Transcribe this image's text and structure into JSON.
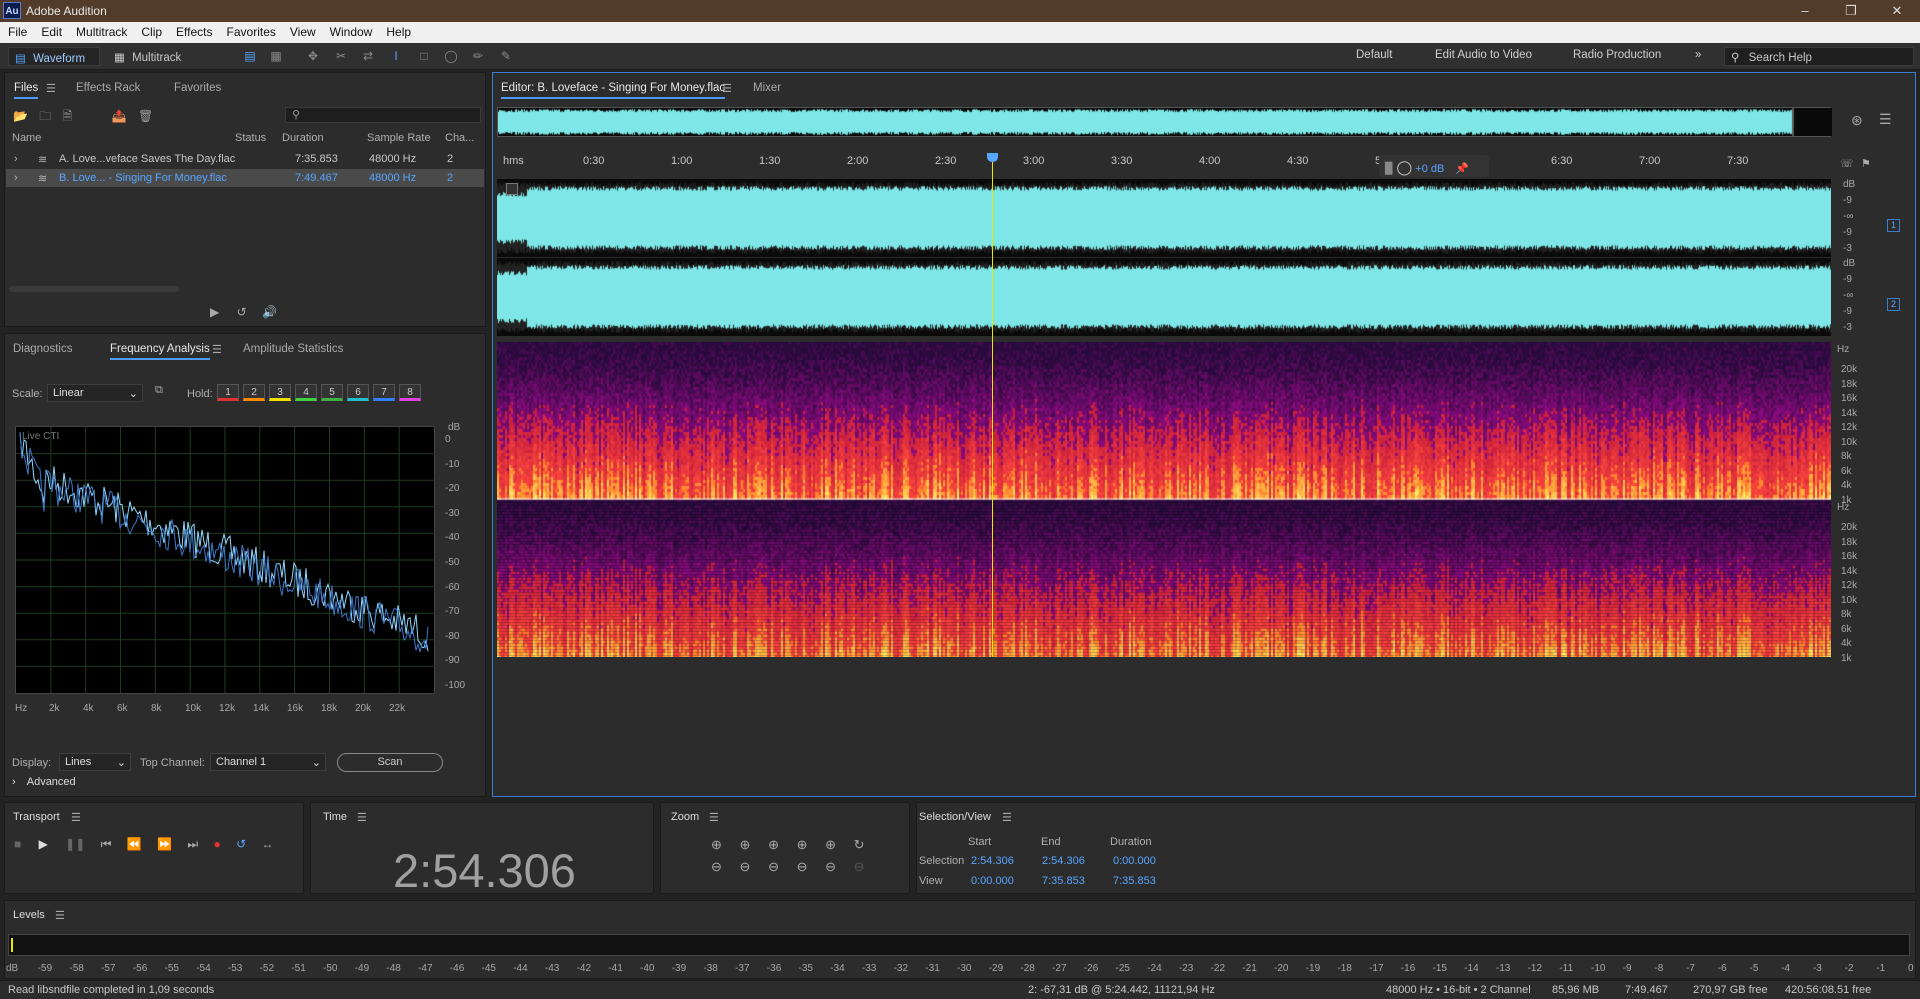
{
  "window": {
    "title": "Adobe Audition",
    "icon_label": "Au"
  },
  "menu": [
    "File",
    "Edit",
    "Multitrack",
    "Clip",
    "Effects",
    "Favorites",
    "View",
    "Window",
    "Help"
  ],
  "toolbar": {
    "waveform_label": "Waveform",
    "multitrack_label": "Multitrack",
    "workspaces": [
      "Default",
      "Edit Audio to Video",
      "Radio Production"
    ],
    "search_placeholder": "Search Help"
  },
  "files_panel": {
    "tabs": [
      "Files",
      "Effects Rack",
      "Favorites"
    ],
    "columns": [
      "Name",
      "Status",
      "Duration",
      "Sample Rate",
      "Cha..."
    ],
    "rows": [
      {
        "name": "A. Love...veface Saves The Day.flac",
        "status": "",
        "duration": "7:35.853",
        "rate": "48000 Hz",
        "ch": "2"
      },
      {
        "name": "B. Love... - Singing For Money.flac",
        "status": "",
        "duration": "7:49.467",
        "rate": "48000 Hz",
        "ch": "2"
      }
    ],
    "selected_row": 1
  },
  "analysis_panel": {
    "tabs": [
      "Diagnostics",
      "Frequency Analysis",
      "Amplitude Statistics"
    ],
    "scale_label": "Scale:",
    "scale_value": "Linear",
    "hold_label": "Hold:",
    "hold_buttons": [
      "1",
      "2",
      "3",
      "4",
      "5",
      "6",
      "7",
      "8"
    ],
    "hold_colors": [
      "#e03030",
      "#ff8a00",
      "#f0e000",
      "#40d040",
      "#40b040",
      "#20c0d0",
      "#3080ff",
      "#e040e0"
    ],
    "live_cti": "Live CTI",
    "db_unit": "dB",
    "db_ticks": [
      "0",
      "-10",
      "-20",
      "-30",
      "-40",
      "-50",
      "-60",
      "-70",
      "-80",
      "-90",
      "-100"
    ],
    "hz_ticks": [
      "Hz",
      "2k",
      "4k",
      "6k",
      "8k",
      "10k",
      "12k",
      "14k",
      "16k",
      "18k",
      "20k",
      "22k"
    ],
    "display_label": "Display:",
    "display_value": "Lines",
    "top_channel_label": "Top Channel:",
    "top_channel_value": "Channel 1",
    "scan_label": "Scan",
    "advanced_label": "Advanced"
  },
  "editor": {
    "tabs": [
      "Editor: B. Loveface - Singing For Money.flac",
      "Mixer"
    ],
    "time_unit": "hms",
    "time_ticks": [
      "0:30",
      "1:00",
      "1:30",
      "2:00",
      "2:30",
      "3:00",
      "3:30",
      "4:00",
      "4:30",
      "5:",
      "6:00",
      "6:30",
      "7:00",
      "7:30"
    ],
    "hud_gain": "+0 dB",
    "channel_db_labels": [
      "dB",
      "-9",
      "-∞",
      "-9",
      "-3"
    ],
    "channel_numbers": [
      "1",
      "2"
    ],
    "hz_unit": "Hz",
    "spectral_ticks": [
      "20k",
      "18k",
      "16k",
      "14k",
      "12k",
      "10k",
      "8k",
      "6k",
      "4k",
      "1k"
    ],
    "playhead_fraction": 0.371
  },
  "transport": {
    "title": "Transport"
  },
  "time_panel": {
    "title": "Time",
    "value": "2:54.306"
  },
  "zoom_panel": {
    "title": "Zoom"
  },
  "selection_panel": {
    "title": "Selection/View",
    "headers": [
      "Start",
      "End",
      "Duration"
    ],
    "rows": [
      {
        "label": "Selection",
        "start": "2:54.306",
        "end": "2:54.306",
        "duration": "0:00.000"
      },
      {
        "label": "View",
        "start": "0:00.000",
        "end": "7:35.853",
        "duration": "7:35.853"
      }
    ]
  },
  "levels": {
    "title": "Levels",
    "scale": [
      "dB",
      "-59",
      "-58",
      "-57",
      "-56",
      "-55",
      "-54",
      "-53",
      "-52",
      "-51",
      "-50",
      "-49",
      "-48",
      "-47",
      "-46",
      "-45",
      "-44",
      "-43",
      "-42",
      "-41",
      "-40",
      "-39",
      "-38",
      "-37",
      "-36",
      "-35",
      "-34",
      "-33",
      "-32",
      "-31",
      "-30",
      "-29",
      "-28",
      "-27",
      "-26",
      "-25",
      "-24",
      "-23",
      "-22",
      "-21",
      "-20",
      "-19",
      "-18",
      "-17",
      "-16",
      "-15",
      "-14",
      "-13",
      "-12",
      "-11",
      "-10",
      "-9",
      "-8",
      "-7",
      "-6",
      "-5",
      "-4",
      "-3",
      "-2",
      "-1",
      "0"
    ]
  },
  "status": {
    "left": "Read libsndfile completed in 1,09 seconds",
    "cursor": "2: -67,31 dB @ 5:24.442, 11121,94 Hz",
    "format": "48000 Hz • 16-bit • 2 Channel",
    "size": "85,96 MB",
    "duration": "7:49.467",
    "free": "270,97 GB free",
    "free_time": "420:56:08.51 free"
  },
  "colors": {
    "waveform": "#7ee6e6",
    "accent": "#4c9bff",
    "playhead": "#e8e800",
    "bg": "#232323"
  }
}
